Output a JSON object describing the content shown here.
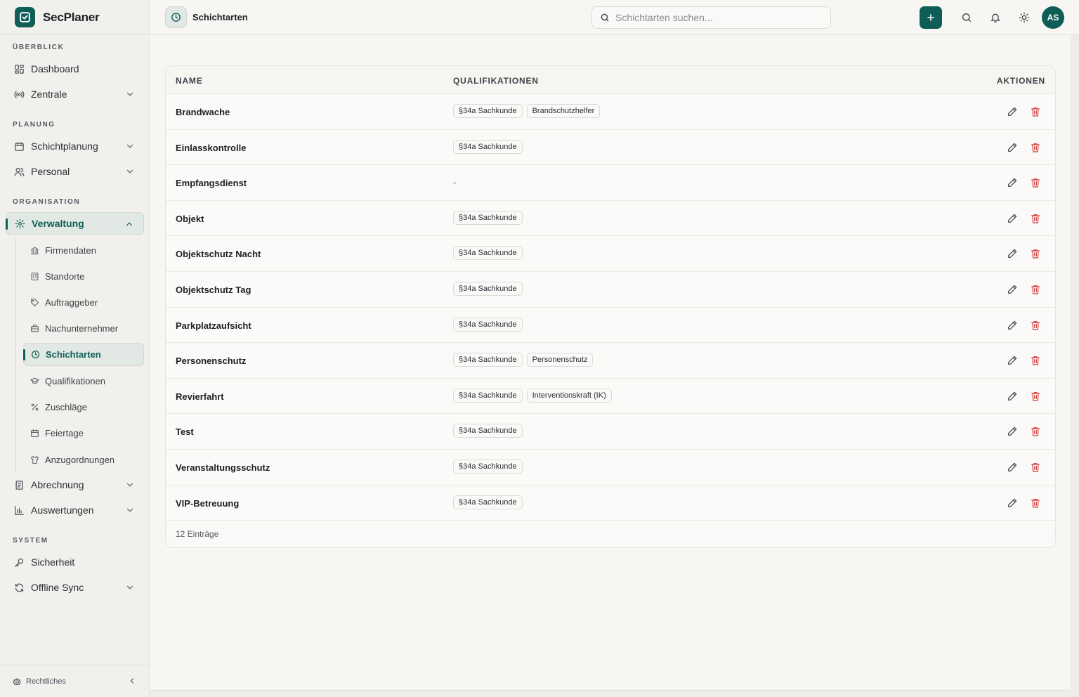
{
  "app": {
    "name": "SecPlaner"
  },
  "header": {
    "title": "Schichtarten",
    "search_placeholder": "Schichtarten suchen...",
    "avatar_initials": "AS"
  },
  "sidebar": {
    "sections": {
      "overview": "ÜBERBLICK",
      "planning": "PLANUNG",
      "organisation": "ORGANISATION",
      "system": "SYSTEM"
    },
    "items": {
      "dashboard": "Dashboard",
      "zentrale": "Zentrale",
      "schichtplanung": "Schichtplanung",
      "personal": "Personal",
      "verwaltung": "Verwaltung",
      "abrechnung": "Abrechnung",
      "auswertungen": "Auswertungen",
      "sicherheit": "Sicherheit",
      "offline_sync": "Offline Sync"
    },
    "sub_items": {
      "firmendaten": "Firmendaten",
      "standorte": "Standorte",
      "auftraggeber": "Auftraggeber",
      "nachunternehmer": "Nachunternehmer",
      "schichtarten": "Schichtarten",
      "qualifikationen": "Qualifikationen",
      "zuschlaege": "Zuschläge",
      "feiertage": "Feiertage",
      "anzugordnungen": "Anzugordnungen"
    },
    "footer": "Rechtliches"
  },
  "table": {
    "columns": {
      "name": "NAME",
      "qualifications": "QUALIFIKATIONEN",
      "actions": "AKTIONEN"
    },
    "rows": [
      {
        "name": "Brandwache",
        "quals": [
          "§34a Sachkunde",
          "Brandschutzhelfer"
        ]
      },
      {
        "name": "Einlasskontrolle",
        "quals": [
          "§34a Sachkunde"
        ]
      },
      {
        "name": "Empfangsdienst",
        "quals": [],
        "empty": "-"
      },
      {
        "name": "Objekt",
        "quals": [
          "§34a Sachkunde"
        ]
      },
      {
        "name": "Objektschutz Nacht",
        "quals": [
          "§34a Sachkunde"
        ]
      },
      {
        "name": "Objektschutz Tag",
        "quals": [
          "§34a Sachkunde"
        ]
      },
      {
        "name": "Parkplatzaufsicht",
        "quals": [
          "§34a Sachkunde"
        ]
      },
      {
        "name": "Personenschutz",
        "quals": [
          "§34a Sachkunde",
          "Personenschutz"
        ]
      },
      {
        "name": "Revierfahrt",
        "quals": [
          "§34a Sachkunde",
          "Interventionskraft (IK)"
        ]
      },
      {
        "name": "Test",
        "quals": [
          "§34a Sachkunde"
        ]
      },
      {
        "name": "Veranstaltungsschutz",
        "quals": [
          "§34a Sachkunde"
        ]
      },
      {
        "name": "VIP-Betreuung",
        "quals": [
          "§34a Sachkunde"
        ]
      }
    ],
    "footer": "12 Einträge"
  },
  "colors": {
    "accent": "#0e5e57",
    "danger": "#d23b3b"
  }
}
